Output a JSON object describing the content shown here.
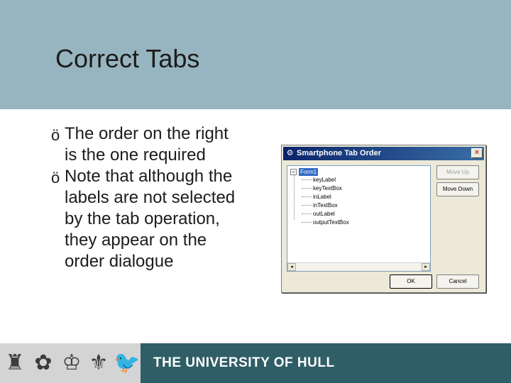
{
  "slide": {
    "title": "Correct Tabs",
    "bullets": [
      "The order on the right is the one required",
      "Note that although the labels are not selected by the tab operation, they appear on the order dialogue"
    ],
    "bullet_glyph": "ö"
  },
  "dialog": {
    "title": "Smartphone Tab Order",
    "close_label": "×",
    "tree": {
      "root": "Form1",
      "expander": "−",
      "items": [
        "keyLabel",
        "keyTextBox",
        "inLabel",
        "inTextBox",
        "outLabel",
        "outputTextBox"
      ]
    },
    "scroll_left": "◂",
    "scroll_right": "▸",
    "buttons": {
      "move_up": "Move Up",
      "move_down": "Move Down",
      "ok": "OK",
      "cancel": "Cancel"
    }
  },
  "footer": {
    "university_name": "THE UNIVERSITY OF HULL",
    "crests": [
      "♜",
      "✿",
      "♔",
      "⚜",
      "🐦"
    ]
  },
  "colors": {
    "header_band": "#97b5c0",
    "footer_band": "#2f5e66",
    "titlebar": "#0a246a"
  }
}
